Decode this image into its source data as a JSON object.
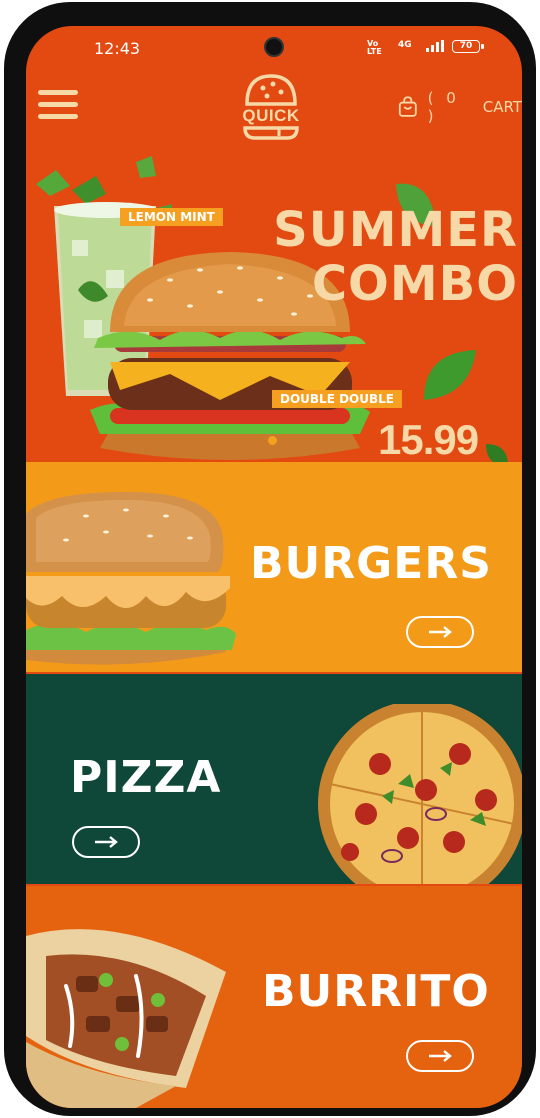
{
  "status_bar": {
    "time": "12:43",
    "network_top": "Vo",
    "network_bottom": "LTE",
    "signal": "4G",
    "battery": "70"
  },
  "header": {
    "logo_text": "QUICK",
    "cart_count": "( 0 )",
    "cart_label": "CART"
  },
  "hero": {
    "tag_drink": "LEMON MINT",
    "tag_burger": "DOUBLE DOUBLE",
    "title_line1": "SUMMER",
    "title_line2": "COMBO",
    "price": "15.99"
  },
  "categories": [
    {
      "label": "BURGERS",
      "bg": "#f39a18"
    },
    {
      "label": "PIZZA",
      "bg": "#0f4739"
    },
    {
      "label": "BURRITO",
      "bg": "#e5620f"
    }
  ],
  "colors": {
    "primary": "#e24a12",
    "cream": "#f7d9a8",
    "tag": "#f5a020"
  }
}
